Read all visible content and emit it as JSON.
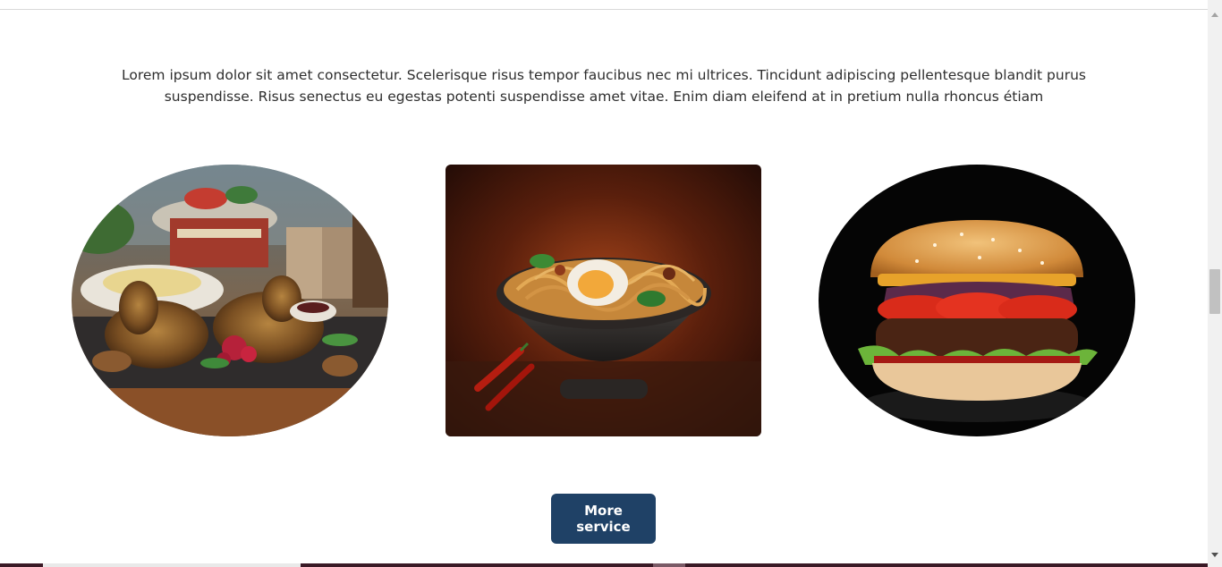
{
  "intro": {
    "text": "Lorem ipsum dolor sit amet consectetur. Scelerisque risus tempor faucibus nec mi ultrices. Tincidunt adipiscing pellentesque blandit purus suspendisse. Risus senectus eu egestas potenti suspendisse amet vitae. Enim diam eleifend at in pretium nulla rhoncus étiam"
  },
  "gallery": {
    "items": [
      {
        "subject": "roasted chicken platter",
        "shape": "oval"
      },
      {
        "subject": "noodle bowl with egg and chili",
        "shape": "rounded-rectangle"
      },
      {
        "subject": "burger",
        "shape": "oval"
      }
    ]
  },
  "actions": {
    "more_service_label": "More service"
  },
  "colors": {
    "button_bg": "#1f4166",
    "button_text": "#ffffff",
    "body_text": "#2e2e2e",
    "scrollbar_track": "#f1f1f1",
    "scrollbar_thumb": "#c1c1c1"
  }
}
